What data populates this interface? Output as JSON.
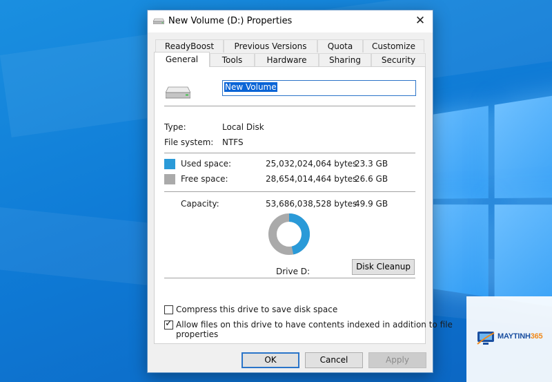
{
  "window": {
    "title": "New Volume (D:) Properties",
    "close_glyph": "✕"
  },
  "tabs_row1": [
    "ReadyBoost",
    "Previous Versions",
    "Quota",
    "Customize"
  ],
  "tabs_row2": [
    "General",
    "Tools",
    "Hardware",
    "Sharing",
    "Security"
  ],
  "active_tab": "General",
  "general": {
    "volume_name": "New Volume",
    "type_label": "Type:",
    "type_value": "Local Disk",
    "fs_label": "File system:",
    "fs_value": "NTFS",
    "used_label": "Used space:",
    "used_bytes": "25,032,024,064 bytes",
    "used_gb": "23.3 GB",
    "free_label": "Free space:",
    "free_bytes": "28,654,014,464 bytes",
    "free_gb": "26.6 GB",
    "capacity_label": "Capacity:",
    "capacity_bytes": "53,686,038,528 bytes",
    "capacity_gb": "49.9 GB",
    "drive_label": "Drive D:",
    "disk_cleanup": "Disk Cleanup",
    "compress_label": "Compress this drive to save disk space",
    "compress_checked": false,
    "index_label_line1": "Allow files on this drive to have contents indexed in addition to file",
    "index_label_line2": "properties",
    "index_checked": true,
    "used_fraction": 0.466
  },
  "colors": {
    "used": "#2a9ad8",
    "free": "#aaaaaa"
  },
  "footer": {
    "ok": "OK",
    "cancel": "Cancel",
    "apply": "Apply"
  },
  "watermark": {
    "brand_main": "MAYTINH",
    "brand_num": "365"
  },
  "icons": [
    "drive-icon",
    "close-icon",
    "check-icon",
    "logo-icon"
  ]
}
